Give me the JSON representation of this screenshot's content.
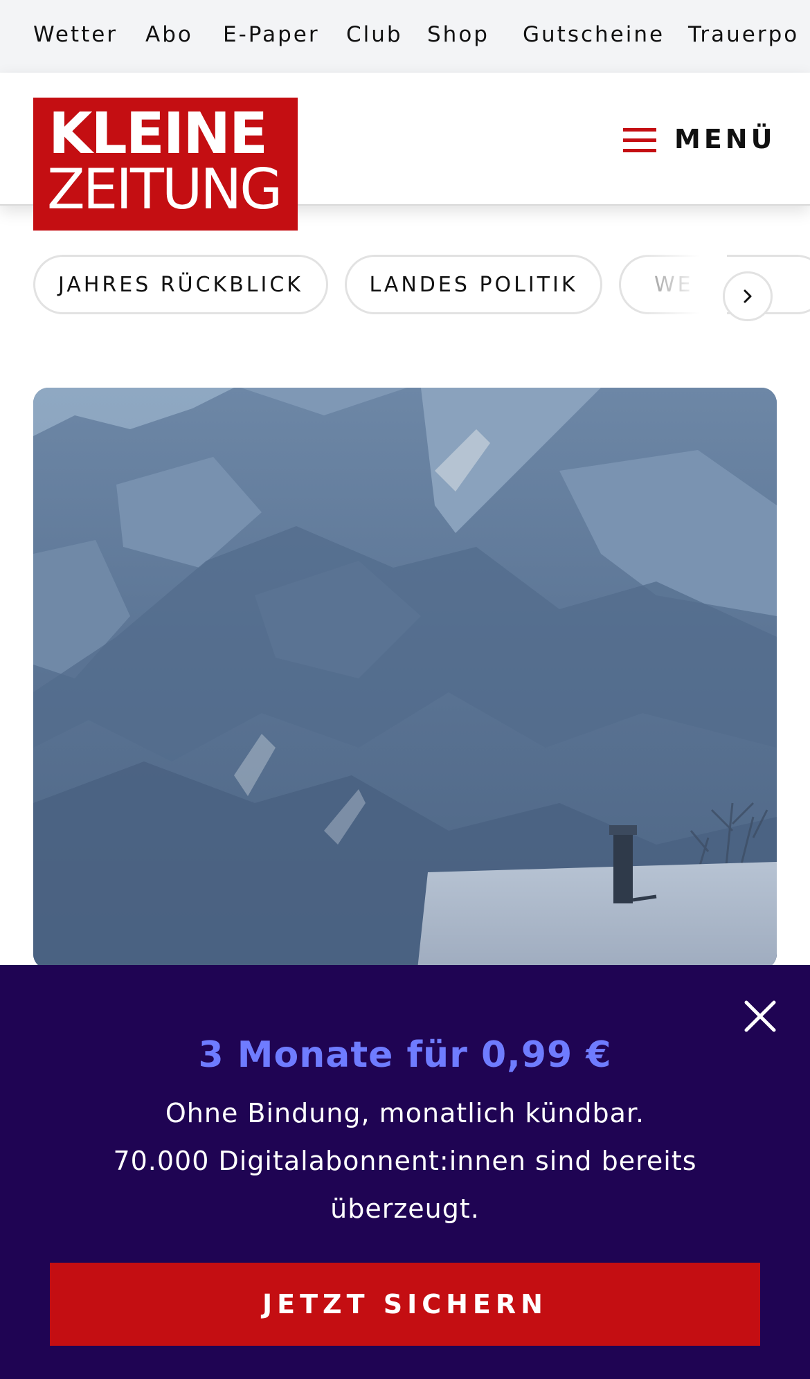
{
  "topnav": {
    "items": [
      "Wetter",
      "Abo",
      "E-Paper",
      "Club",
      "Shop",
      "Gutscheine",
      "Trauerpo"
    ]
  },
  "header": {
    "logo_line1": "KLEINE",
    "logo_line2": "ZEITUNG",
    "menu_label": "MENÜ"
  },
  "topics": {
    "chips": [
      "JAHRES RÜCKBLICK",
      "LANDES POLITIK",
      "WE"
    ]
  },
  "hero": {
    "image_alt": "snow-covered-mountains-photo"
  },
  "promo": {
    "headline": "3 Monate für 0,99 €",
    "line1": "Ohne Bindung, monatlich kündbar.",
    "line2": "70.000 Digitalabonnent:innen sind bereits überzeugt.",
    "cta": "JETZT SICHERN"
  },
  "colors": {
    "brand_red": "#c40e12",
    "promo_bg": "#1f0453",
    "promo_accent": "#6f7cff"
  }
}
